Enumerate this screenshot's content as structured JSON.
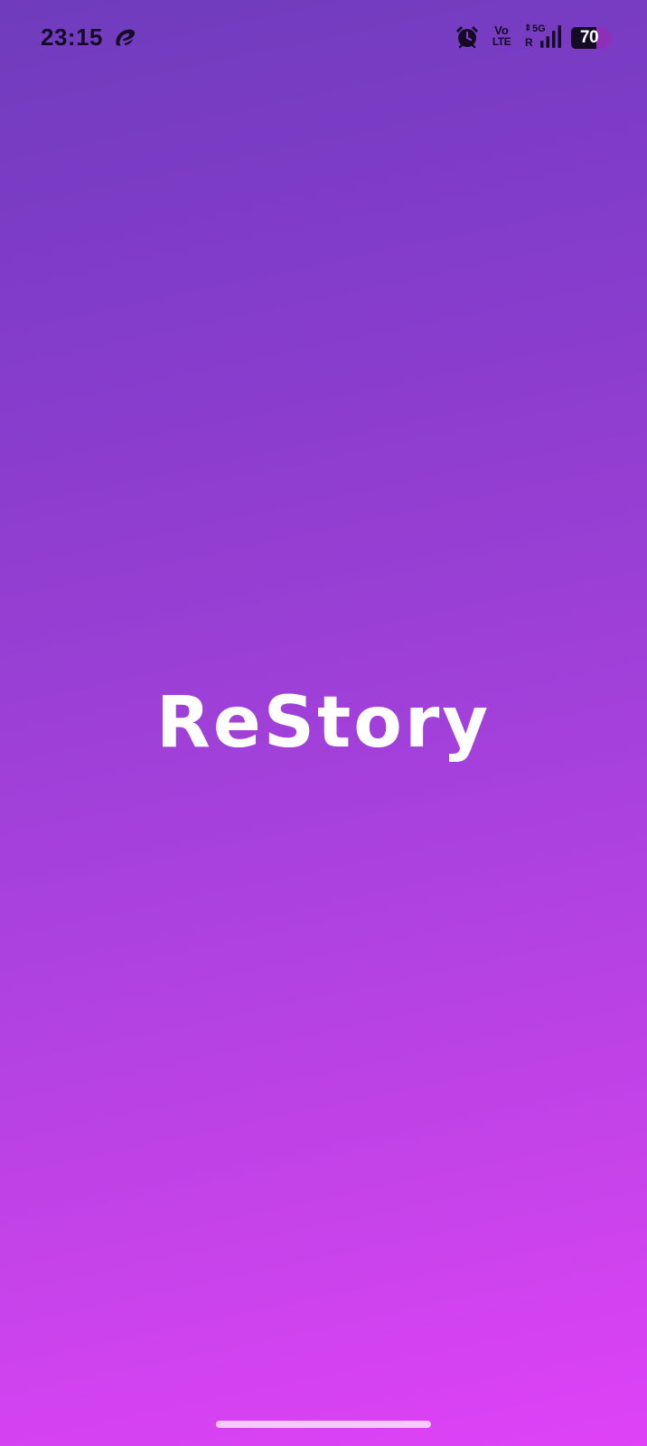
{
  "status_bar": {
    "time": "23:15",
    "carrier_icon": "airtel-logo-icon",
    "alarm_icon": "alarm-clock-icon",
    "volte_top": "Vo",
    "volte_bottom": "LTE",
    "network_arrows": "⇕",
    "network_type": "5G",
    "roaming": "R",
    "signal_icon": "signal-bars-icon",
    "battery_level": 70,
    "battery_text": "70"
  },
  "splash": {
    "app_name": "ReStory"
  },
  "colors": {
    "gradient_start": "#6f3cbd",
    "gradient_end": "#df42f7",
    "title_color": "#ffffff",
    "status_icon_color": "#140a26"
  }
}
